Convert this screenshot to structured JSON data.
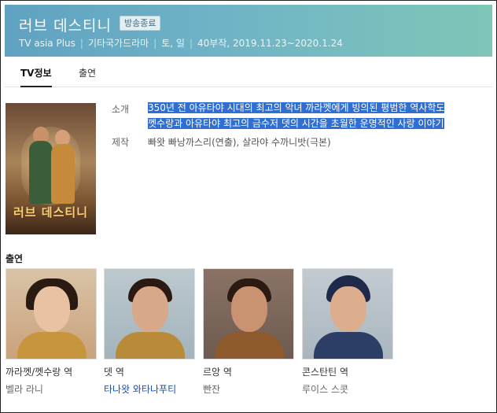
{
  "header": {
    "title": "러브 데스티니",
    "badge": "방송종료",
    "channel": "TV asia Plus",
    "genre": "기타국가드라마",
    "days": "토, 일",
    "episodes": "40부작, 2019.11.23~2020.1.24",
    "gradient_start": "#5fa2c2",
    "gradient_end": "#7fc6b8"
  },
  "tabs": [
    {
      "label": "TV정보",
      "active": true
    },
    {
      "label": "출연",
      "active": false
    }
  ],
  "poster": {
    "title": "러브 데스티니"
  },
  "info": {
    "intro_label": "소개",
    "intro_line1": "350년 전 아유타야 시대의 최고의 악녀 까라껫에게 빙의된 평범한 역사학도",
    "intro_line2": "껫수랑과 아유타야 최고의 금수저 뎃의 시간을 초월한 운명적인 사랑 이야기",
    "producer_label": "제작",
    "producer": "빠왓 빠낭까스리(연출), 살라야 수까니밧(극본)",
    "highlight_color": "#2f6fd3"
  },
  "cast_section": {
    "title": "출연",
    "members": [
      {
        "role": "까라껫/껫수랑 역",
        "actor": "벨라 라니"
      },
      {
        "role": "뎃 역",
        "actor": "타나왓 와타나푸티"
      },
      {
        "role": "르앙 역",
        "actor": "빤잔"
      },
      {
        "role": "콘스탄틴 역",
        "actor": "루이스 스콧"
      }
    ]
  }
}
